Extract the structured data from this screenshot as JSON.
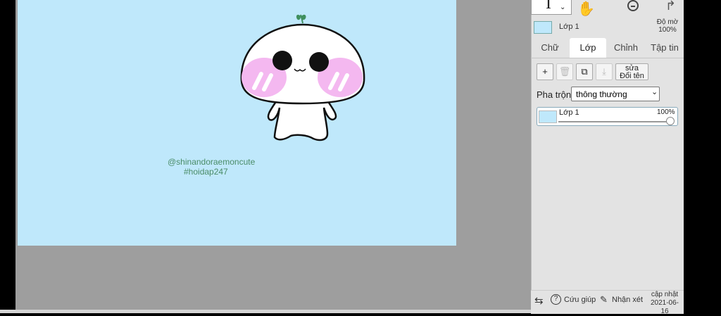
{
  "canvas": {
    "background": "#bfe8fb",
    "credit_handle": "@shinandoraemoncute",
    "credit_tag": "#hoidap247"
  },
  "toolbar": {
    "current_tool": "text-cursor-icon",
    "hand": "hand-icon",
    "zoom_out": "zoom-out-icon",
    "redo": "redo-icon"
  },
  "layer_header": {
    "name": "Lớp 1",
    "opacity_label": "Độ mờ",
    "opacity_value": "100%"
  },
  "tabs": [
    {
      "label": "Chữ",
      "active": false
    },
    {
      "label": "Lớp",
      "active": true
    },
    {
      "label": "Chỉnh",
      "active": false
    },
    {
      "label": "Tập tin",
      "active": false
    }
  ],
  "layer_actions": {
    "add": "+",
    "delete": "trash-icon",
    "duplicate": "duplicate-icon",
    "merge": "merge-down-icon",
    "rename_line1": "sửa",
    "rename_line2": "Đổi tên"
  },
  "blend": {
    "label": "Pha trộn",
    "value": "thông thường"
  },
  "layers": [
    {
      "name": "Lớp 1",
      "opacity": "100%",
      "opacity_fraction": 1.0
    }
  ],
  "footer": {
    "swap": "swap-icon",
    "help": "Cứu giúp",
    "feedback": "Nhận xét",
    "update_label": "cập nhật",
    "update_date": "2021-06-16"
  },
  "colors": {
    "workspace": "#9e9e9e",
    "panel": "#e3e3e3",
    "credit": "#4a8c67",
    "sprout": "#3f8f5e"
  }
}
